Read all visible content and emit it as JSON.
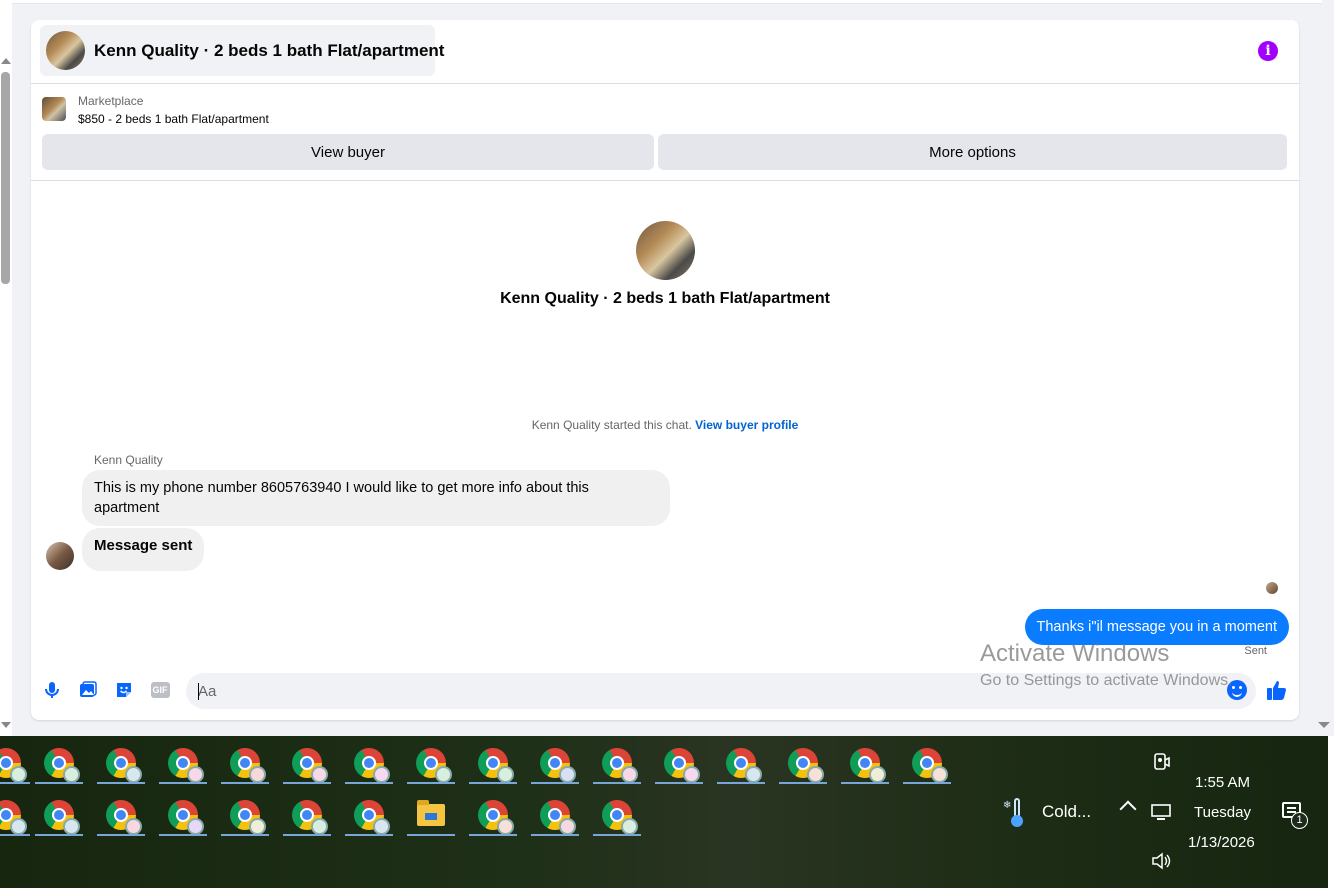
{
  "conversation": {
    "title": "Kenn Quality · 2 beds 1 bath Flat/apartment",
    "info_icon": "info-icon"
  },
  "listing": {
    "source": "Marketplace",
    "summary": "$850 - 2 beds 1 bath Flat/apartment",
    "view_buyer_label": "View buyer",
    "more_options_label": "More options"
  },
  "intro": {
    "title": "Kenn Quality · 2 beds 1 bath Flat/apartment",
    "started_text": "Kenn Quality started this chat.",
    "buyer_profile_link": "View buyer profile"
  },
  "messages": {
    "sender_name": "Kenn Quality",
    "incoming_1": "This is my phone number 8605763940 I would like to get more info about this apartment",
    "incoming_2": "Message sent",
    "outgoing_1": "Thanks i\"il message you in a moment",
    "status": "Sent"
  },
  "composer": {
    "placeholder": "Aa",
    "gif_label": "GIF"
  },
  "watermark": {
    "line1": "Activate Windows",
    "line2": "Go to Settings to activate Windows."
  },
  "taskbar": {
    "weather": "Cold...",
    "time": "1:55 AM",
    "day": "Tuesday",
    "date": "1/13/2026",
    "notification_count": "1"
  },
  "colors": {
    "accent": "#0866ff",
    "outgoing_bubble": "#0a7cff",
    "info": "#a100ff",
    "link": "#0064d1"
  }
}
